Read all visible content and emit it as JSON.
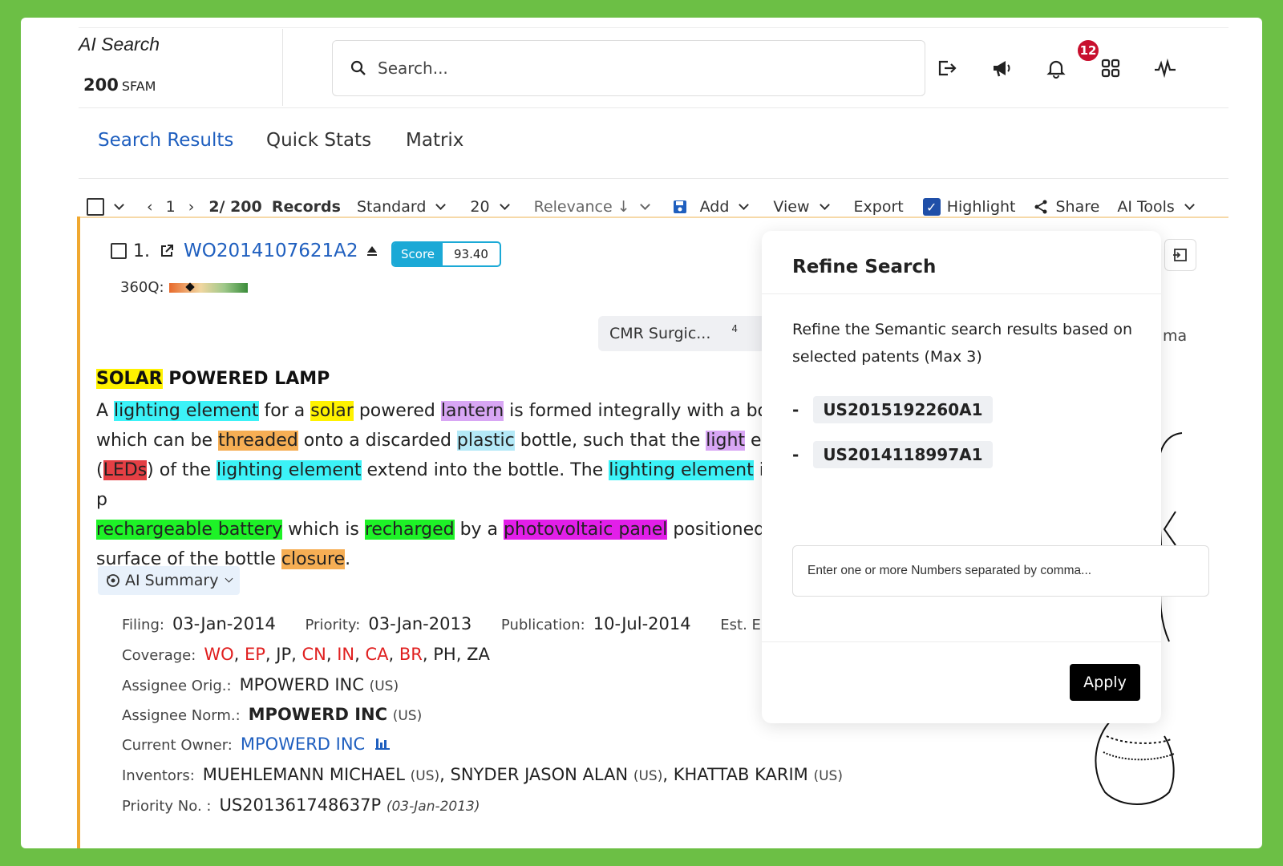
{
  "header": {
    "brand_title": "AI Search",
    "count": "200",
    "count_unit": "SFAM",
    "search_placeholder": "Search...",
    "notification_count": "12"
  },
  "tabs": [
    {
      "label": "Search Results",
      "active": true
    },
    {
      "label": "Quick Stats",
      "active": false
    },
    {
      "label": "Matrix",
      "active": false
    }
  ],
  "toolbar": {
    "page": "1",
    "records_count": "2/ 200",
    "records_label": "Records",
    "view_mode": "Standard",
    "per_page": "20",
    "sort": "Relevance ↓",
    "add": "Add",
    "view": "View",
    "export": "Export",
    "highlight": "Highlight",
    "share": "Share",
    "ai_tools": "AI Tools"
  },
  "record": {
    "index": "1.",
    "number": "WO2014107621A2",
    "score_label": "Score",
    "score_value": "93.40",
    "q360_label": "360Q:",
    "chip_label": "CMR Surgic...",
    "chip_count": "4",
    "title_hl": "SOLAR",
    "title_rest": " POWERED LAMP",
    "abstract": [
      {
        "t": "A "
      },
      {
        "t": "lighting element",
        "hl": "c"
      },
      {
        "t": " for a "
      },
      {
        "t": "solar",
        "hl": "y"
      },
      {
        "t": " powered "
      },
      {
        "t": "lantern",
        "hl": "p"
      },
      {
        "t": " is formed integrally with a bot"
      },
      {
        "t": "\nwhich can be "
      },
      {
        "t": "threaded",
        "hl": "o"
      },
      {
        "t": " onto a discarded "
      },
      {
        "t": "plastic",
        "hl": "b"
      },
      {
        "t": " bottle, such that the "
      },
      {
        "t": "light",
        "hl": "p"
      },
      {
        "t": " em"
      },
      {
        "t": "\n("
      },
      {
        "t": "LEDs",
        "hl": "r"
      },
      {
        "t": ") of the "
      },
      {
        "t": "lighting element",
        "hl": "c"
      },
      {
        "t": " extend into the bottle. The "
      },
      {
        "t": "lighting element",
        "hl": "c"
      },
      {
        "t": " is p"
      },
      {
        "t": "\n"
      },
      {
        "t": "rechargeable battery",
        "hl": "g"
      },
      {
        "t": " which is "
      },
      {
        "t": "recharged",
        "hl": "g"
      },
      {
        "t": " by a "
      },
      {
        "t": "photovoltaic panel",
        "hl": "m"
      },
      {
        "t": " positioned c"
      },
      {
        "t": "\nsurface of the bottle "
      },
      {
        "t": "closure",
        "hl": "o"
      },
      {
        "t": "."
      }
    ],
    "ai_summary": "AI Summary",
    "filing_label": "Filing:",
    "filing": "03-Jan-2014",
    "priority_label": "Priority:",
    "priority": "03-Jan-2013",
    "publication_label": "Publication:",
    "publication": "10-Jul-2014",
    "est_label": "Est. E:",
    "coverage_label": "Coverage:",
    "coverage": [
      {
        "c": "WO",
        "red": true
      },
      {
        "c": "EP",
        "red": true
      },
      {
        "c": "JP",
        "red": false
      },
      {
        "c": "CN",
        "red": true
      },
      {
        "c": "IN",
        "red": true
      },
      {
        "c": "CA",
        "red": true
      },
      {
        "c": "BR",
        "red": true
      },
      {
        "c": "PH",
        "red": false
      },
      {
        "c": "ZA",
        "red": false
      }
    ],
    "assignee_orig_label": "Assignee Orig.:",
    "assignee_orig": "MPOWERD INC",
    "assignee_orig_cc": "(US)",
    "assignee_norm_label": "Assignee Norm.:",
    "assignee_norm": "MPOWERD INC",
    "assignee_norm_cc": "(US)",
    "owner_label": "Current Owner:",
    "owner": "MPOWERD INC",
    "inventors_label": "Inventors:",
    "inventor1": "MUEHLEMANN MICHAEL",
    "inventor1_cc": "(US)",
    "inventor2": "SNYDER JASON ALAN",
    "inventor2_cc": "(US)",
    "inventor3": "KHATTAB KARIM",
    "inventor3_cc": "(US)",
    "priority_no_label": "Priority No. :",
    "priority_no": "US201361748637P",
    "priority_no_date": "(03-Jan-2013)"
  },
  "refine": {
    "title": "Refine Search",
    "description": "Refine the Semantic search results based on selected patents (Max 3)",
    "patents": [
      "US2015192260A1",
      "US2014118997A1"
    ],
    "input_placeholder": "Enter one or more Numbers separated by comma...",
    "apply": "Apply"
  },
  "side_text": "ma"
}
